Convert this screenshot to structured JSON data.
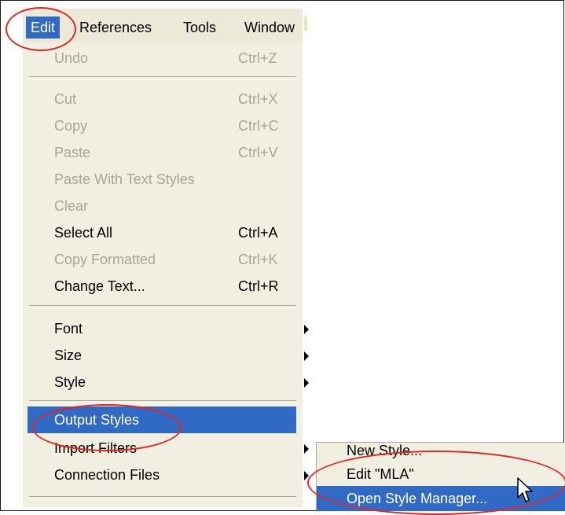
{
  "menubar": {
    "items": [
      "Edit",
      "References",
      "Tools",
      "Window"
    ],
    "active": "Edit"
  },
  "edit_menu": {
    "undo": {
      "label": "Undo",
      "shortcut": "Ctrl+Z",
      "enabled": false
    },
    "cut": {
      "label": "Cut",
      "shortcut": "Ctrl+X",
      "enabled": false
    },
    "copy": {
      "label": "Copy",
      "shortcut": "Ctrl+C",
      "enabled": false
    },
    "paste": {
      "label": "Paste",
      "shortcut": "Ctrl+V",
      "enabled": false
    },
    "paste_text_styles": {
      "label": "Paste With Text Styles",
      "enabled": false
    },
    "clear": {
      "label": "Clear",
      "enabled": false
    },
    "select_all": {
      "label": "Select All",
      "shortcut": "Ctrl+A",
      "enabled": true
    },
    "copy_formatted": {
      "label": "Copy Formatted",
      "shortcut": "Ctrl+K",
      "enabled": false
    },
    "change_text": {
      "label": "Change Text...",
      "shortcut": "Ctrl+R",
      "enabled": true
    },
    "font": {
      "label": "Font"
    },
    "size": {
      "label": "Size"
    },
    "style": {
      "label": "Style"
    },
    "output_styles": {
      "label": "Output Styles",
      "highlighted": true
    },
    "import_filters": {
      "label": "Import Filters"
    },
    "connection_files": {
      "label": "Connection Files"
    }
  },
  "output_styles_submenu": {
    "new_style": "New Style...",
    "edit_style": "Edit \"MLA\"",
    "open_style_manager": "Open Style Manager...",
    "highlighted": "open_style_manager"
  },
  "colors": {
    "highlight": "#316ac5",
    "menu_bg": "#f1efe2",
    "disabled_text": "#a8a49a",
    "annotation": "#e3261f"
  },
  "icons": [
    "submenu-arrow-icon",
    "mouse-pointer-icon"
  ]
}
